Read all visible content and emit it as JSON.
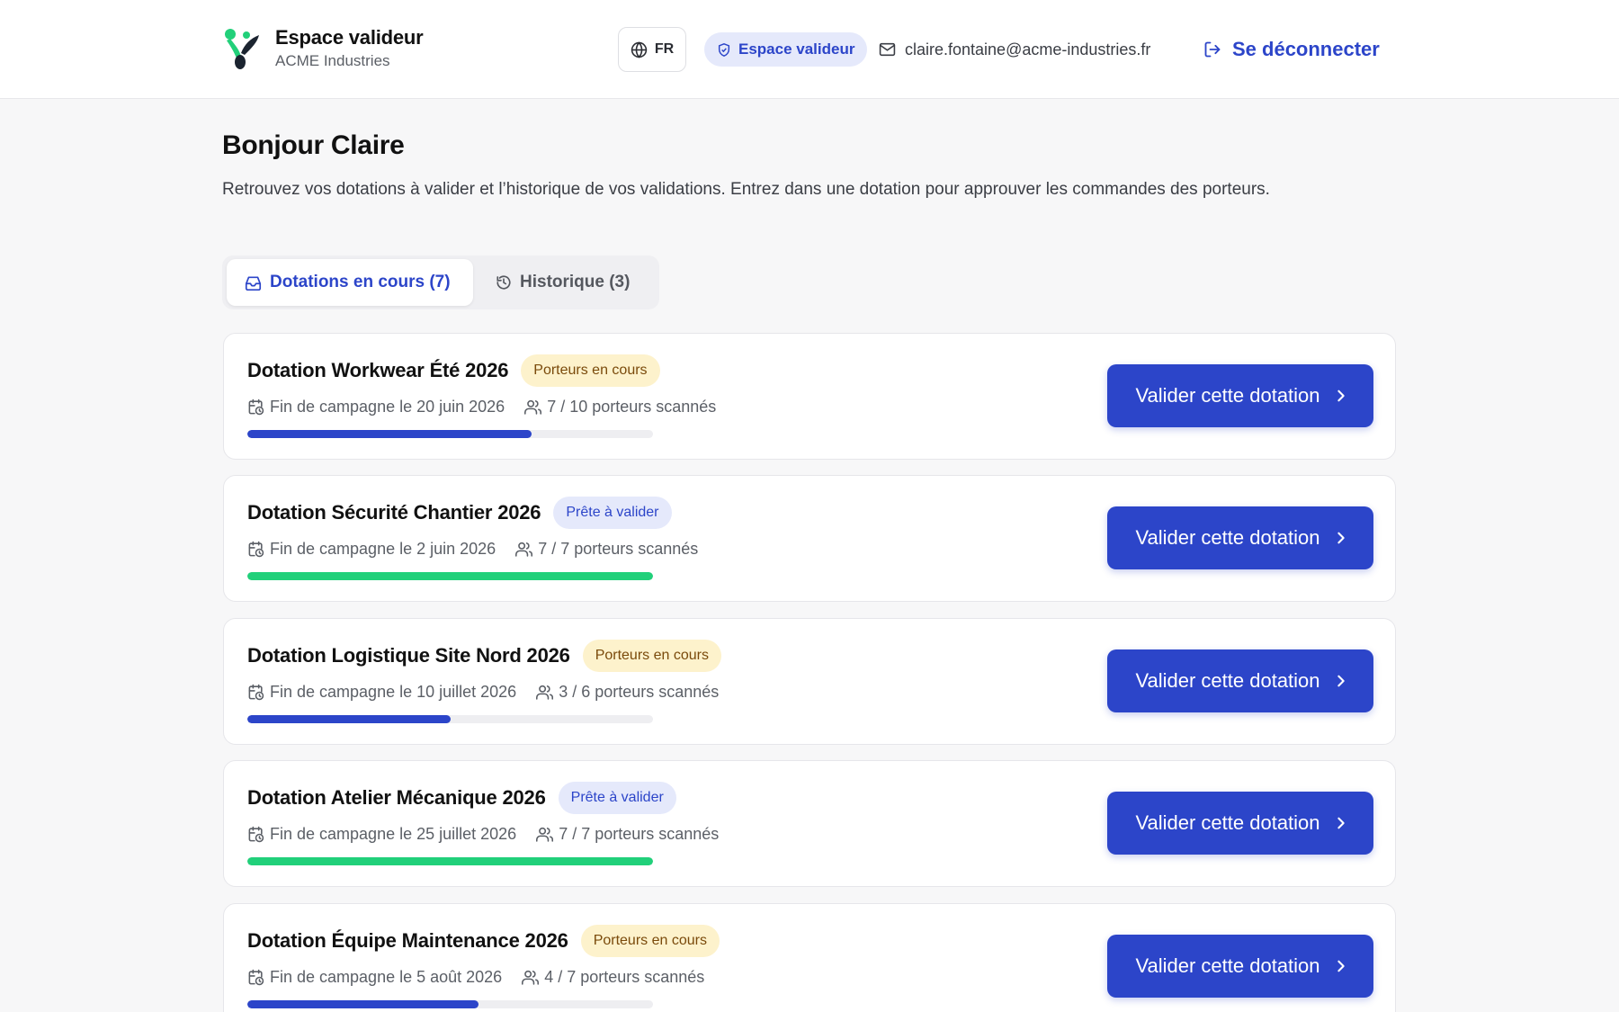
{
  "header": {
    "brand_title": "Espace valideur",
    "brand_subtitle": "ACME Industries",
    "language": "FR",
    "role_badge": "Espace valideur",
    "user_email": "claire.fontaine@acme-industries.fr",
    "logout_label": "Se déconnecter"
  },
  "main": {
    "greeting": "Bonjour Claire",
    "intro": "Retrouvez vos dotations à valider et l’historique de vos validations. Entrez dans une dotation pour approuver les commandes des porteurs.",
    "tabs": [
      {
        "label": "Dotations en cours (7)",
        "active": true
      },
      {
        "label": "Historique (3)",
        "active": false
      }
    ]
  },
  "dotations": [
    {
      "title": "Dotation Workwear Été 2026",
      "status": "Porteurs en cours",
      "status_kind": "progress",
      "end_date": "Fin de campagne le 20 juin 2026",
      "scanned": "7 / 10 porteurs scannés",
      "progress": 0.7,
      "action": "Valider cette dotation"
    },
    {
      "title": "Dotation Sécurité Chantier 2026",
      "status": "Prête à valider",
      "status_kind": "ready",
      "end_date": "Fin de campagne le 2 juin 2026",
      "scanned": "7 / 7 porteurs scannés",
      "progress": 1.0,
      "action": "Valider cette dotation"
    },
    {
      "title": "Dotation Logistique Site Nord 2026",
      "status": "Porteurs en cours",
      "status_kind": "progress",
      "end_date": "Fin de campagne le 10 juillet 2026",
      "scanned": "3 / 6 porteurs scannés",
      "progress": 0.5,
      "action": "Valider cette dotation"
    },
    {
      "title": "Dotation Atelier Mécanique 2026",
      "status": "Prête à valider",
      "status_kind": "ready",
      "end_date": "Fin de campagne le 25 juillet 2026",
      "scanned": "7 / 7 porteurs scannés",
      "progress": 1.0,
      "action": "Valider cette dotation"
    },
    {
      "title": "Dotation Équipe Maintenance 2026",
      "status": "Porteurs en cours",
      "status_kind": "progress",
      "end_date": "Fin de campagne le 5 août 2026",
      "scanned": "4 / 7 porteurs scannés",
      "progress": 0.57,
      "action": "Valider cette dotation"
    }
  ],
  "colors": {
    "accent": "#2c45c9",
    "ready_bar": "#21d07a",
    "progress_badge_bg": "#fdf2cc",
    "ready_badge_bg": "#e5e9fb"
  },
  "icons": {
    "logo": "brand-logo",
    "language": "globe-icon",
    "role": "shield-check-icon",
    "email": "mail-icon",
    "logout": "logout-icon",
    "tab_current": "inbox-icon",
    "tab_history": "history-icon",
    "date": "calendar-clock-icon",
    "people": "users-icon",
    "chevron": "chevron-right-icon"
  }
}
